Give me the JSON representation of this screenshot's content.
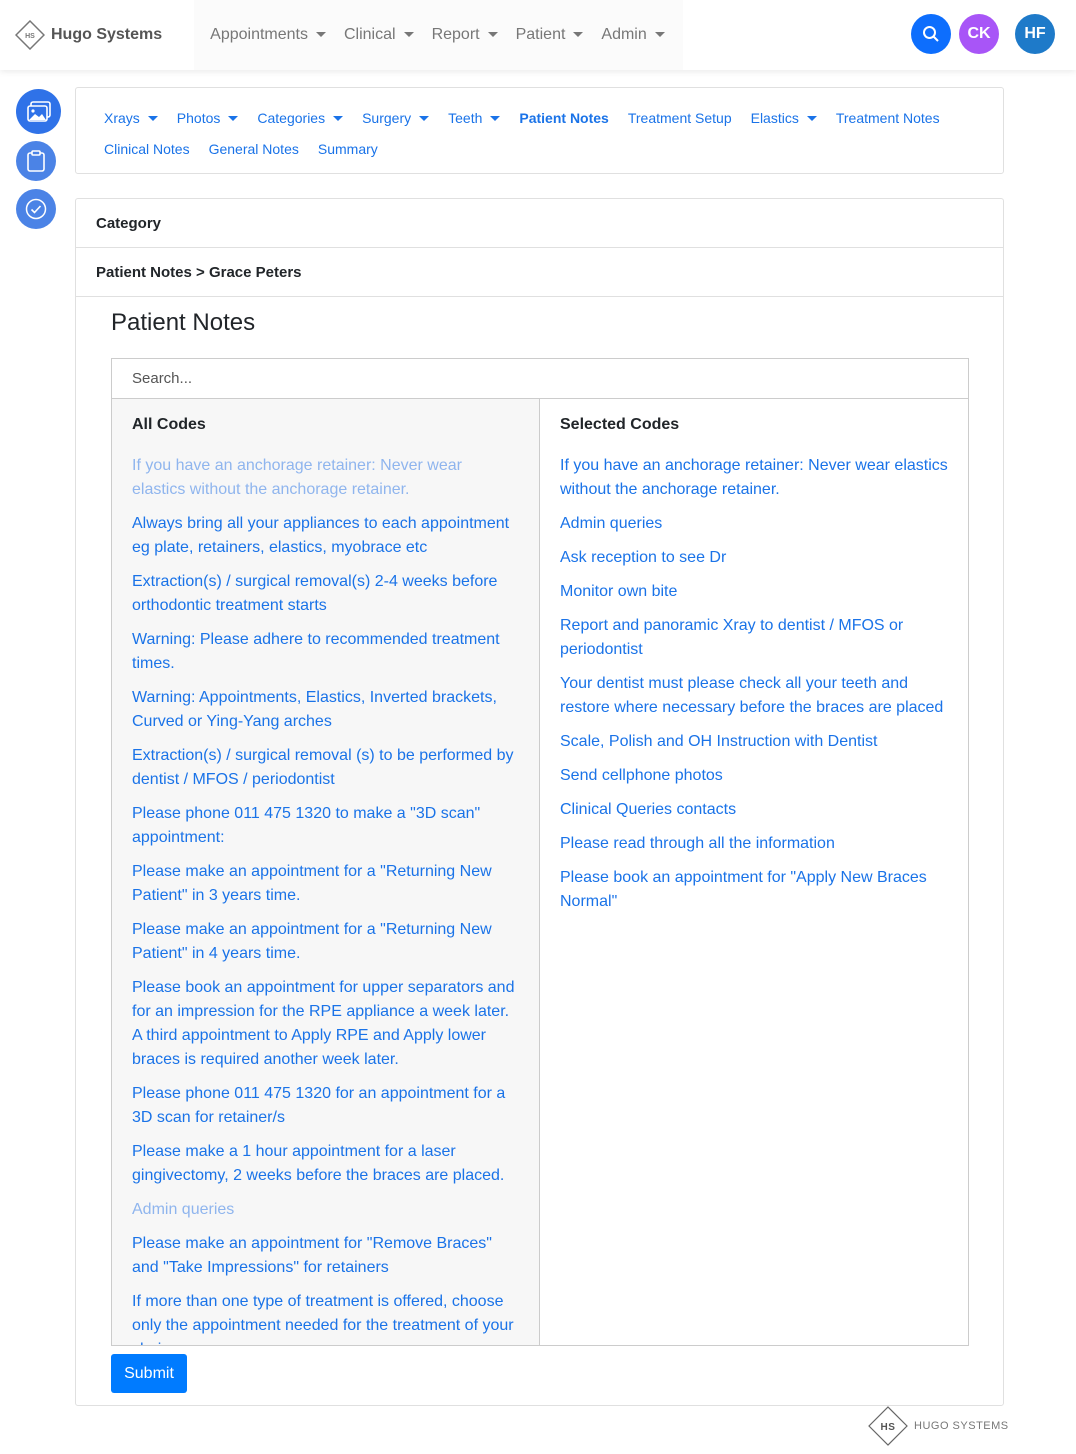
{
  "header": {
    "brand": "Hugo Systems",
    "logo_text": "HS",
    "nav": [
      "Appointments",
      "Clinical",
      "Report",
      "Patient",
      "Admin"
    ],
    "avatars": [
      {
        "initials": "CK",
        "color": "#a855f7"
      },
      {
        "initials": "HF",
        "color": "#1e7ac9"
      }
    ],
    "search_color": "#0d6efd"
  },
  "subnav": {
    "row1": [
      {
        "label": "Xrays",
        "dropdown": true
      },
      {
        "label": "Photos",
        "dropdown": true
      },
      {
        "label": "Categories",
        "dropdown": true
      },
      {
        "label": "Surgery",
        "dropdown": true
      },
      {
        "label": "Teeth",
        "dropdown": true
      },
      {
        "label": "Patient Notes",
        "active": true
      },
      {
        "label": "Treatment Setup"
      },
      {
        "label": "Elastics",
        "dropdown": true
      },
      {
        "label": "Treatment Notes"
      }
    ],
    "row2": [
      "Clinical Notes",
      "General Notes",
      "Summary"
    ]
  },
  "category_label": "Category",
  "breadcrumb": "Patient Notes > Grace Peters",
  "page_title": "Patient Notes",
  "search_placeholder": "Search...",
  "all_codes": {
    "heading": "All Codes",
    "items": [
      {
        "text": "If you have an anchorage retainer: Never wear elastics without the anchorage retainer.",
        "selected": true
      },
      {
        "text": "Always bring all your appliances to each appointment eg plate, retainers, elastics, myobrace etc"
      },
      {
        "text": "Extraction(s) / surgical removal(s) 2-4 weeks before orthodontic treatment starts"
      },
      {
        "text": "Warning: Please adhere to recommended treatment times."
      },
      {
        "text": "Warning: Appointments, Elastics, Inverted brackets, Curved or Ying-Yang arches"
      },
      {
        "text": "Extraction(s) / surgical removal (s) to be performed by dentist / MFOS / periodontist"
      },
      {
        "text": "Please phone 011 475 1320 to make a \"3D scan\" appointment:"
      },
      {
        "text": "Please make an appointment for a \"Returning New Patient\" in 3 years time."
      },
      {
        "text": "Please make an appointment for a \"Returning New Patient\" in 4 years time."
      },
      {
        "text": "Please book an appointment for upper separators and for an impression for the RPE appliance a week later. A third appointment to Apply RPE and Apply lower braces is required another week later."
      },
      {
        "text": "Please phone 011 475 1320 for an appointment for a 3D scan for retainer/s"
      },
      {
        "text": "Please make a 1 hour appointment for a laser gingivectomy, 2 weeks before the braces are placed."
      },
      {
        "text": "Admin queries",
        "selected": true
      },
      {
        "text": "Please make an appointment for \"Remove Braces\" and \"Take Impressions\" for retainers"
      },
      {
        "text": "If more than one type of treatment is offered, choose only the appointment needed for the treatment of your choice."
      }
    ]
  },
  "selected_codes": {
    "heading": "Selected Codes",
    "items": [
      "If you have an anchorage retainer: Never wear elastics without the anchorage retainer.",
      "Admin queries",
      "Ask reception to see Dr",
      "Monitor own bite",
      "Report and panoramic Xray to dentist / MFOS or periodontist",
      "Your dentist must please check all your teeth and restore where necessary before the braces are placed",
      "Scale, Polish and OH Instruction with Dentist",
      "Send cellphone photos",
      "Clinical Queries contacts",
      "Please read through all the information",
      "Please book an appointment for \"Apply New Braces Normal\""
    ]
  },
  "submit_label": "Submit",
  "footer": {
    "logo_text": "HS",
    "brand": "HUGO SYSTEMS"
  }
}
